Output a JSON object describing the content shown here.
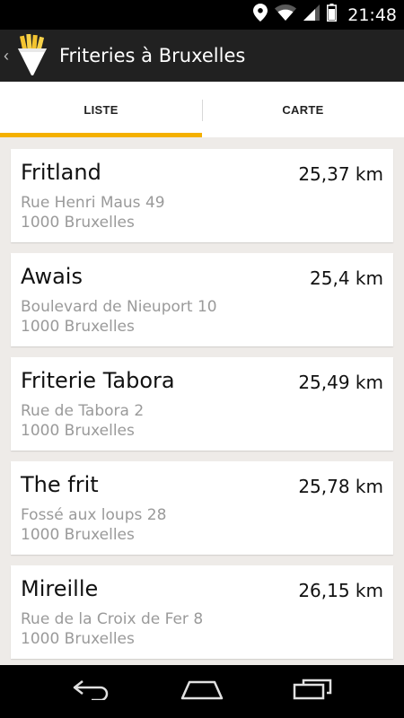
{
  "status_bar": {
    "time": "21:48",
    "icons": [
      "location-icon",
      "wifi-icon",
      "signal-icon",
      "battery-icon"
    ]
  },
  "action_bar": {
    "title": "Friteries à Bruxelles",
    "logo": "fries-cone-icon"
  },
  "tabs": [
    {
      "label": "LISTE",
      "selected": true
    },
    {
      "label": "CARTE",
      "selected": false
    }
  ],
  "accent_color": "#f4b000",
  "friteries": [
    {
      "name": "Fritland",
      "distance": "25,37 km",
      "street": "Rue Henri Maus 49",
      "city": "1000 Bruxelles"
    },
    {
      "name": "Awais",
      "distance": "25,4 km",
      "street": "Boulevard de Nieuport 10",
      "city": "1000 Bruxelles"
    },
    {
      "name": "Friterie Tabora",
      "distance": "25,49 km",
      "street": "Rue de Tabora 2",
      "city": "1000 Bruxelles"
    },
    {
      "name": "The frit",
      "distance": "25,78 km",
      "street": "Fossé aux loups 28",
      "city": "1000 Bruxelles"
    },
    {
      "name": "Mireille",
      "distance": "26,15 km",
      "street": "Rue de la Croix de Fer 8",
      "city": "1000 Bruxelles"
    }
  ],
  "nav_bar": {
    "buttons": [
      "back-icon",
      "home-icon",
      "recent-apps-icon"
    ]
  }
}
